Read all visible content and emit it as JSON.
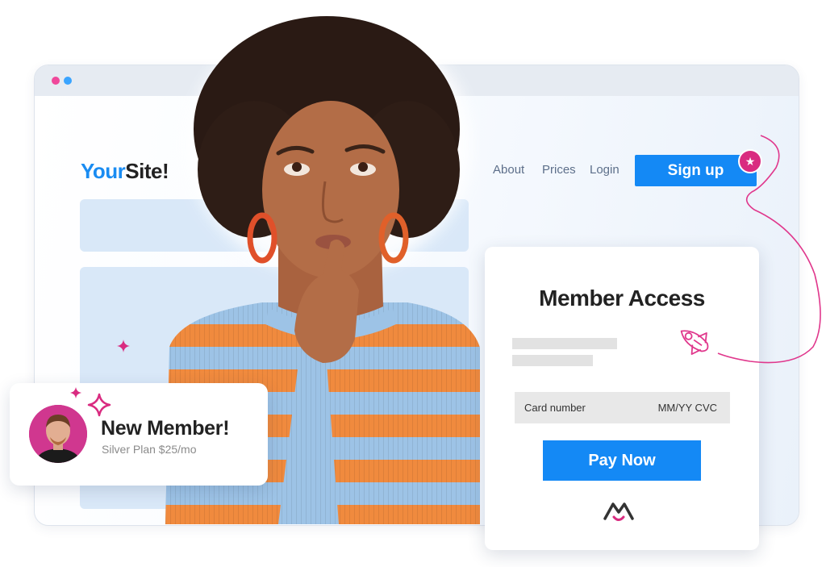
{
  "browser": {
    "window_dots": [
      "pink-dot",
      "blue-dot"
    ],
    "colors": {
      "dot_pink": "#f0489b",
      "dot_blue": "#3aa4ff"
    }
  },
  "site": {
    "logo_part1": "Your",
    "logo_part2": "Site!",
    "nav": [
      {
        "label": "About"
      },
      {
        "label": "Prices"
      },
      {
        "label": "Login"
      }
    ],
    "signup_label": "Sign up",
    "signup_badge_icon": "star-icon"
  },
  "member_access": {
    "title": "Member Access",
    "card_number_placeholder": "Card number",
    "expiry_cvc_placeholder": "MM/YY CVC",
    "pay_button_label": "Pay Now",
    "brand_logo_icon": "memberpress-smile-m-icon",
    "decoration_icon": "rocket-icon"
  },
  "notification": {
    "title": "New Member!",
    "subtitle": "Silver Plan $25/mo",
    "decoration_icon": "sparkle-icon"
  },
  "colors": {
    "primary": "#1489f5",
    "accent": "#d92b80",
    "text_dark": "#222222",
    "nav_text": "#5d6f8a"
  }
}
